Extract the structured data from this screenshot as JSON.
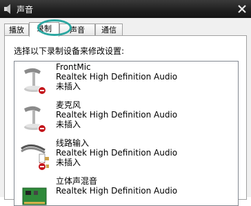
{
  "window": {
    "title": "声音"
  },
  "tabs": [
    {
      "label": "播放",
      "active": false
    },
    {
      "label": "录制",
      "active": true
    },
    {
      "label": "声音",
      "active": false
    },
    {
      "label": "通信",
      "active": false
    }
  ],
  "panel": {
    "instruction": "选择以下录制设备来修改设置:"
  },
  "devices": [
    {
      "name": "FrontMic",
      "description": "Realtek High Definition Audio",
      "status": "未插入",
      "icon": "microphone-icon"
    },
    {
      "name": "麦克风",
      "description": "Realtek High Definition Audio",
      "status": "未插入",
      "icon": "microphone-icon"
    },
    {
      "name": "线路输入",
      "description": "Realtek High Definition Audio",
      "status": "未插入",
      "icon": "line-in-cable-icon"
    },
    {
      "name": "立体声混音",
      "description": "Realtek High Definition Audio",
      "status": "",
      "icon": "sound-card-icon"
    }
  ],
  "colors": {
    "highlight_ring": "#2aa6a0",
    "disconnected_badge": "#c3141b"
  }
}
